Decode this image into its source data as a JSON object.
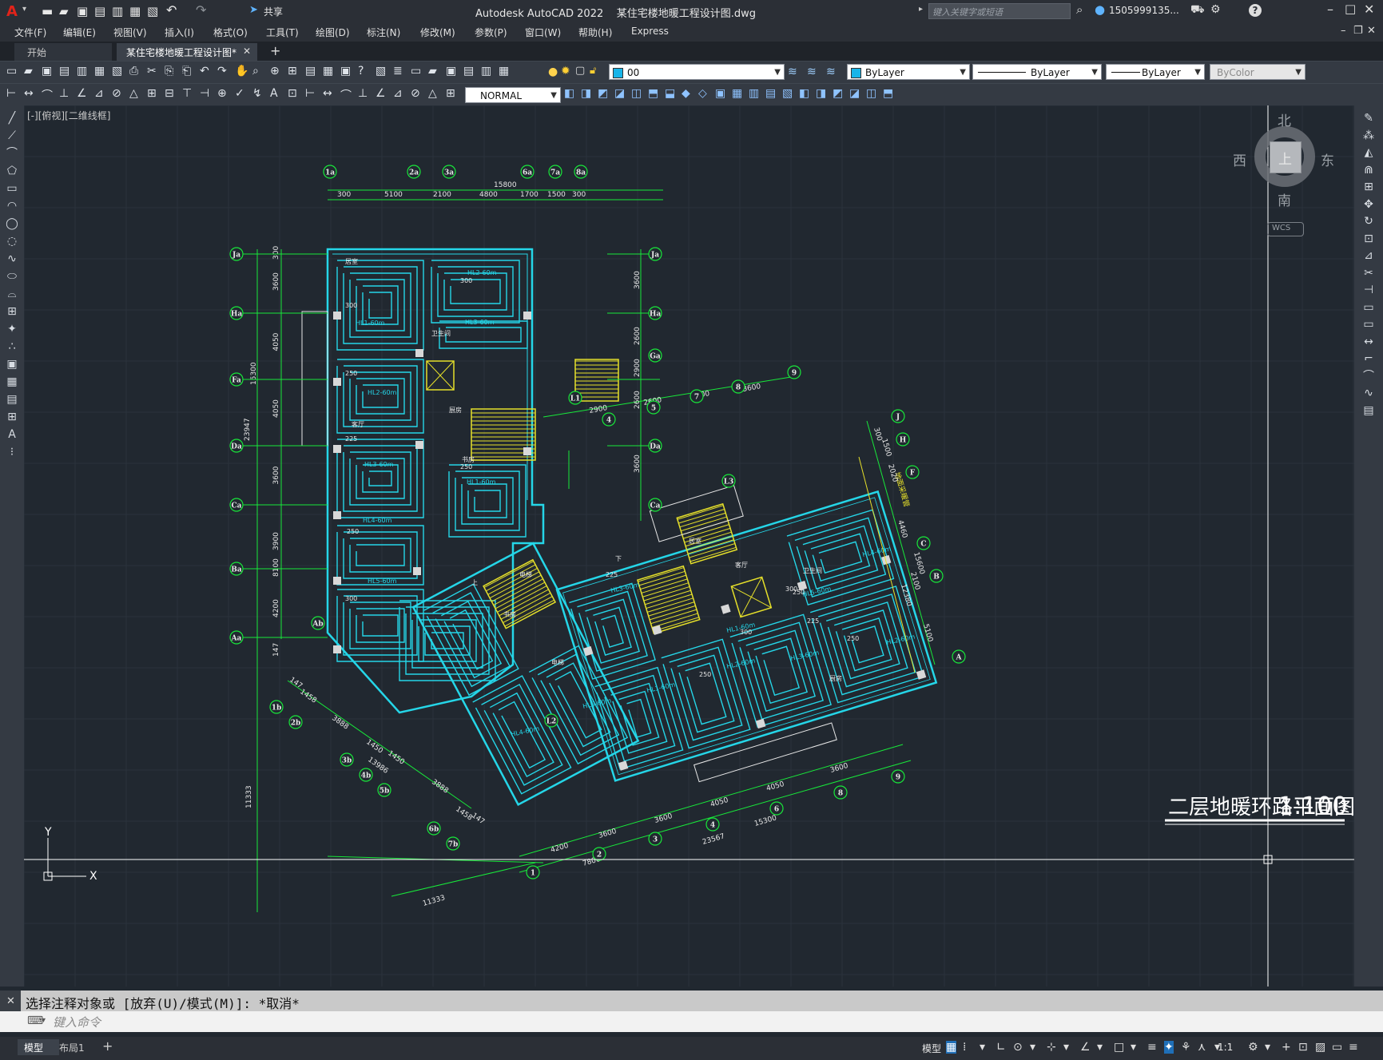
{
  "titlebar": {
    "app_letter": "A",
    "share_label": "共享",
    "title": "Autodesk AutoCAD 2022    某住宅楼地暖工程设计图.dwg",
    "search_placeholder": "键入关键字或短语",
    "user": "1505999135...",
    "help": "?"
  },
  "menu": [
    "文件(F)",
    "编辑(E)",
    "视图(V)",
    "插入(I)",
    "格式(O)",
    "工具(T)",
    "绘图(D)",
    "标注(N)",
    "修改(M)",
    "参数(P)",
    "窗口(W)",
    "帮助(H)",
    "Express"
  ],
  "tabs": [
    {
      "label": "开始"
    },
    {
      "label": "某住宅楼地暖工程设计图*"
    }
  ],
  "properties": {
    "layer": "00",
    "color": "ByLayer",
    "linetype": "ByLayer",
    "lineweight": "ByLayer",
    "plotstyle": "ByColor",
    "textstyle": "NORMAL"
  },
  "viewport": {
    "label": "[-][俯视][二维线框]",
    "viewcube": {
      "north": "北",
      "south": "南",
      "east": "东",
      "west": "西",
      "top": "上",
      "wcs": "WCS"
    },
    "ucs_x": "X",
    "ucs_y": "Y"
  },
  "drawing": {
    "title": "二层地暖环路平面图",
    "scale": "1:100",
    "left_axes": [
      "Ja",
      "Ha",
      "Fa",
      "Da",
      "Ca",
      "Ba",
      "Aa",
      "Ab"
    ],
    "top_axes": [
      "1a",
      "2a",
      "3a",
      "6a",
      "7a",
      "8a"
    ],
    "top_dims": [
      "300",
      "5100",
      "2100",
      "4800",
      "1700",
      "1500",
      "300"
    ],
    "top_total": "15800",
    "left_dims": [
      "300",
      "3600",
      "4050",
      "4050",
      "3600",
      "3900",
      "4200",
      "147"
    ],
    "left_totals": [
      "15300",
      "23947",
      "8100",
      "11333"
    ],
    "right_axes": [
      "J",
      "H",
      "F",
      "C",
      "B",
      "A"
    ],
    "bottom_axes": [
      "1",
      "2",
      "3",
      "4",
      "6",
      "8",
      "9"
    ],
    "bottom_dims": [
      "4200",
      "3600",
      "3600",
      "4050",
      "4050",
      "3600"
    ],
    "bottom_totals": [
      "7800",
      "15300",
      "23567",
      "11333"
    ],
    "diag_axes": [
      "1b",
      "2b",
      "3b",
      "4b",
      "5b",
      "6b",
      "7b"
    ],
    "diag_dims": [
      "147",
      "1458",
      "3888",
      "1450",
      "1450",
      "13986",
      "3888",
      "1458",
      "147"
    ],
    "upper_axes": [
      "4",
      "5",
      "7",
      "8",
      "9"
    ],
    "upper_dims": [
      "2900",
      "2600",
      "3600",
      "3600"
    ],
    "right_dims": [
      "300",
      "1500",
      "2020",
      "4460",
      "15600",
      "2100",
      "12380",
      "5100"
    ],
    "circuits": [
      "HL1-60m",
      "HL2-60m",
      "HL3-60m",
      "HL4-60m",
      "HL5-60m"
    ],
    "room_labels": [
      "居室",
      "客厅",
      "卫生间",
      "厨房",
      "书房",
      "电梯",
      "上",
      "下"
    ],
    "misc_values": [
      "300",
      "250",
      "225",
      "250",
      "300"
    ],
    "lift_labels": [
      "L1",
      "L2",
      "L3"
    ],
    "side_text": "地面采暖管"
  },
  "command": {
    "history": "选择注释对象或 [放弃(U)/模式(M)]: *取消*",
    "placeholder": "键入命令"
  },
  "status": {
    "model_tab": "模型",
    "layout_tab": "布局1",
    "model_btn": "模型",
    "scale": "1:1"
  }
}
